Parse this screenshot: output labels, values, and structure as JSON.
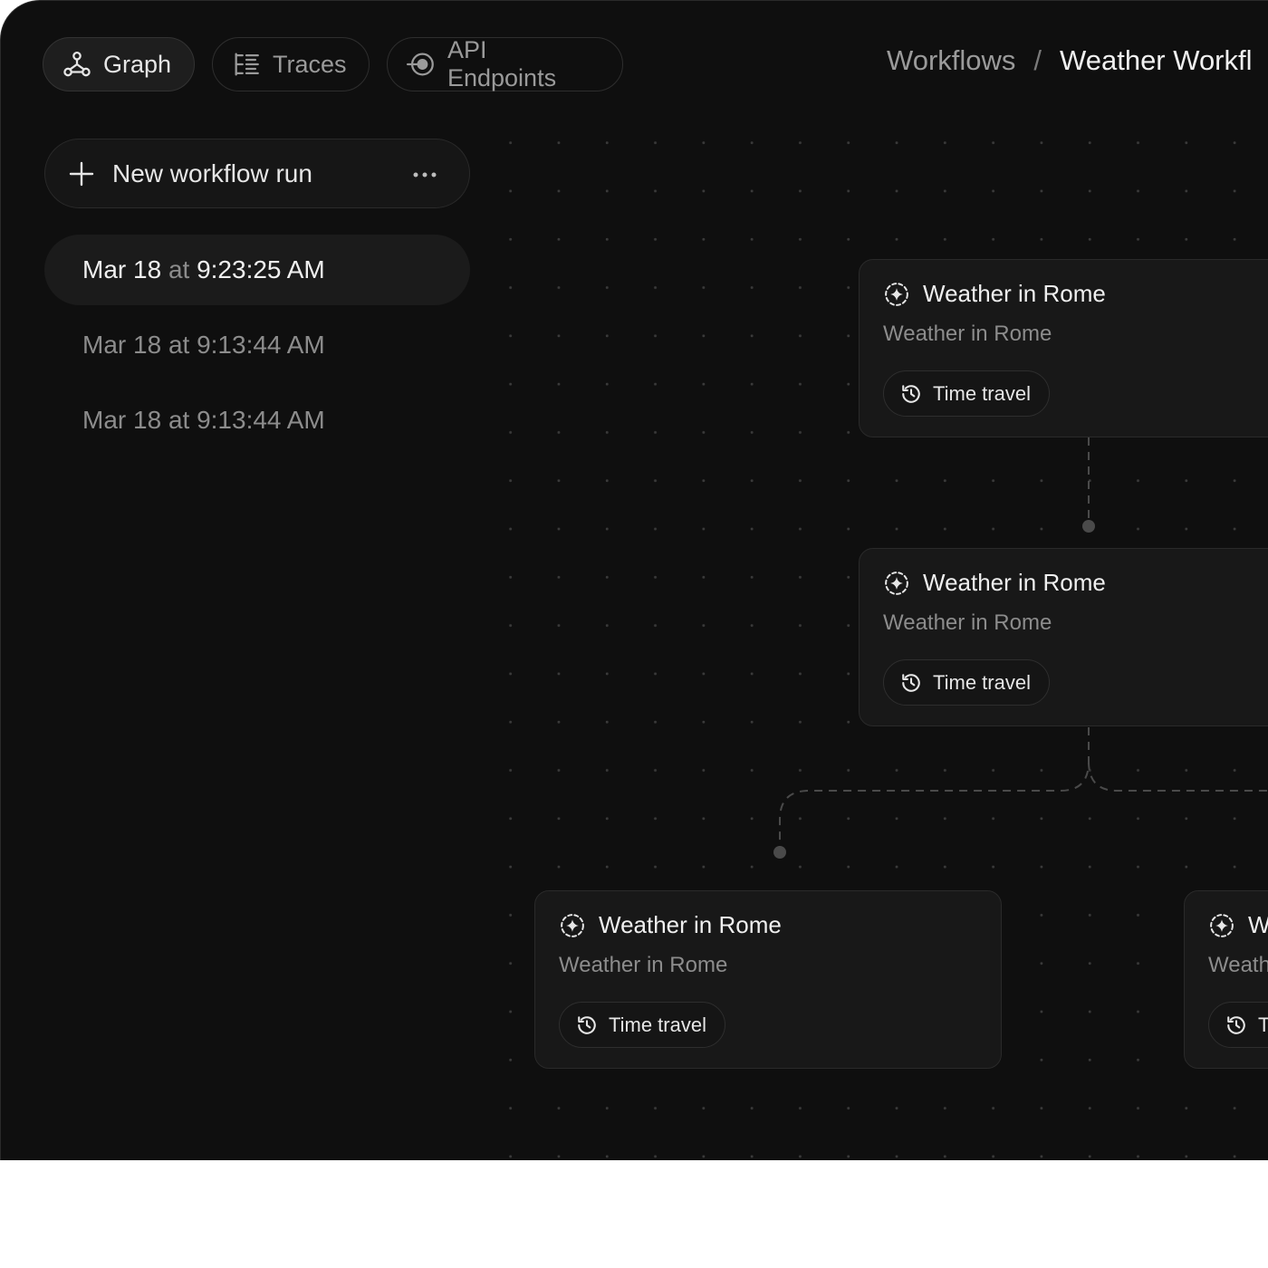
{
  "tabs": [
    {
      "label": "Graph",
      "icon": "graph-icon",
      "active": true
    },
    {
      "label": "Traces",
      "icon": "traces-icon",
      "active": false
    },
    {
      "label": "API Endpoints",
      "icon": "api-endpoints-icon",
      "active": false
    }
  ],
  "breadcrumb": {
    "root": "Workflows",
    "separator": "/",
    "current": "Weather Workfl"
  },
  "sidebar": {
    "new_run_label": "New workflow run",
    "more_icon": "more-horizontal-icon",
    "runs": [
      {
        "date": "Mar 18",
        "at": "at",
        "time": "9:23:25 AM",
        "selected": true
      },
      {
        "date": "Mar 18",
        "at": "at",
        "time": "9:13:44 AM",
        "selected": false
      },
      {
        "date": "Mar 18",
        "at": "at",
        "time": "9:13:44 AM",
        "selected": false
      }
    ]
  },
  "nodes": [
    {
      "title": "Weather in Rome",
      "subtitle": "Weather in Rome",
      "button": "Time travel"
    },
    {
      "title": "Weather in Rome",
      "subtitle": "Weather in Rome",
      "button": "Time travel"
    },
    {
      "title": "Weather in Rome",
      "subtitle": "Weather in Rome",
      "button": "Time travel"
    },
    {
      "title": "Weather in Rome",
      "subtitle": "Weather in Rome",
      "button": "Time travel"
    }
  ],
  "colors": {
    "background": "#0f0f0f",
    "panel": "#181818",
    "border": "#2a2a2a",
    "text_primary": "#f0f0f0",
    "text_muted": "#8c8c8c"
  }
}
